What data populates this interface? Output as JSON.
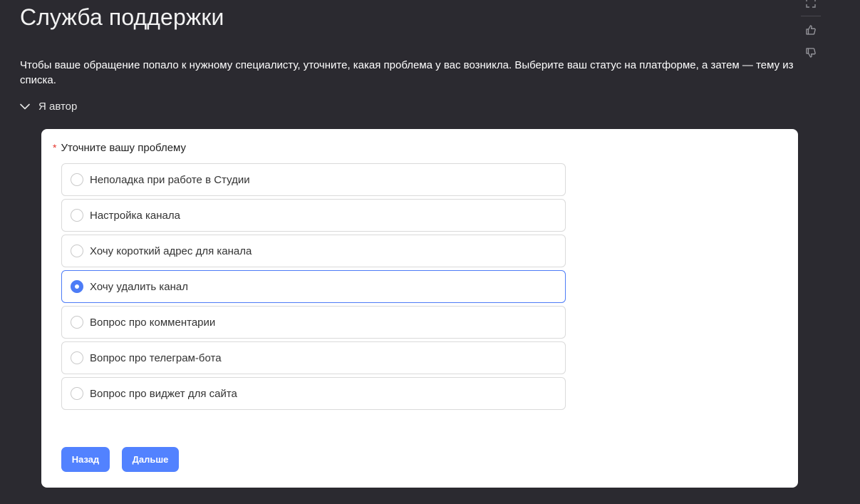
{
  "header": {
    "title": "Служба поддержки",
    "intro": "Чтобы ваше обращение попало к нужному специалисту, уточните, какая проблема у вас возникла. Выберите ваш статус на платформе, а затем — тему из списка."
  },
  "section": {
    "label": "Я автор",
    "icon": "chevron-down-icon"
  },
  "rail": {
    "icons": [
      "fullscreen-icon",
      "thumbs-up-icon",
      "thumbs-down-icon"
    ]
  },
  "form": {
    "required_mark": "*",
    "question": "Уточните вашу проблему",
    "options": [
      {
        "label": "Неполадка при работе в Студии",
        "selected": false
      },
      {
        "label": "Настройка канала",
        "selected": false
      },
      {
        "label": "Хочу короткий адрес для канала",
        "selected": false
      },
      {
        "label": "Хочу удалить канал",
        "selected": true
      },
      {
        "label": "Вопрос про комментарии",
        "selected": false
      },
      {
        "label": "Вопрос про телеграм-бота",
        "selected": false
      },
      {
        "label": "Вопрос про виджет для сайта",
        "selected": false
      }
    ],
    "back_label": "Назад",
    "next_label": "Дальше"
  },
  "colors": {
    "background": "#2b2a30",
    "accent": "#5282ff",
    "selected_border": "#4d7cf6",
    "required": "#e5342b"
  }
}
